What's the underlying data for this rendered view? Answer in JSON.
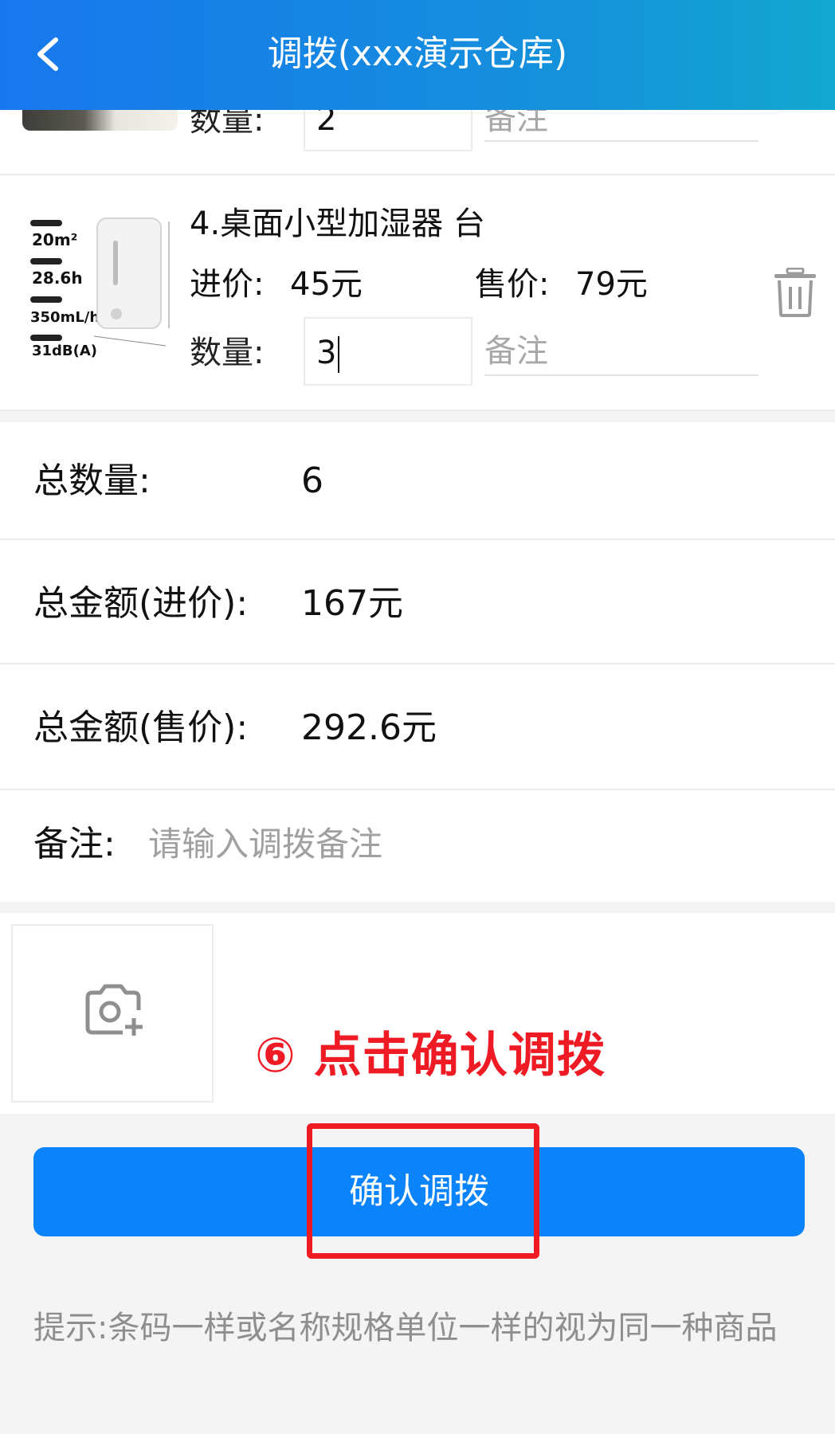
{
  "header": {
    "title": "调拨(xxx演示仓库)"
  },
  "item_prev": {
    "qty_label": "数量:",
    "qty_value": "2",
    "remark_placeholder": "备注"
  },
  "item": {
    "name": "4.桌面小型加湿器  台",
    "cost_label": "进价:",
    "cost_value": "45元",
    "sale_label": "售价:",
    "sale_value": "79元",
    "qty_label": "数量:",
    "qty_value": "3",
    "remark_placeholder": "备注",
    "image_specs": [
      "20m²",
      "28.6h",
      "350mL/h",
      "31dB(A)"
    ]
  },
  "summary": {
    "total_qty_label": "总数量:",
    "total_qty_value": "6",
    "total_cost_label": "总金额(进价):",
    "total_cost_value": "167元",
    "total_sale_label": "总金额(售价):",
    "total_sale_value": "292.6元"
  },
  "remark": {
    "label": "备注:",
    "placeholder": "请输入调拨备注"
  },
  "annotation": "⑥ 点击确认调拨",
  "confirm_button": "确认调拨",
  "hint": "提示:条码一样或名称规格单位一样的视为同一种商品",
  "colors": {
    "header_start": "#1877ee",
    "header_end": "#13a8cf",
    "button": "#0b83fa",
    "annotation": "#ee1b24"
  },
  "icons": [
    "back-chevron-icon",
    "trash-icon",
    "camera-add-icon"
  ]
}
